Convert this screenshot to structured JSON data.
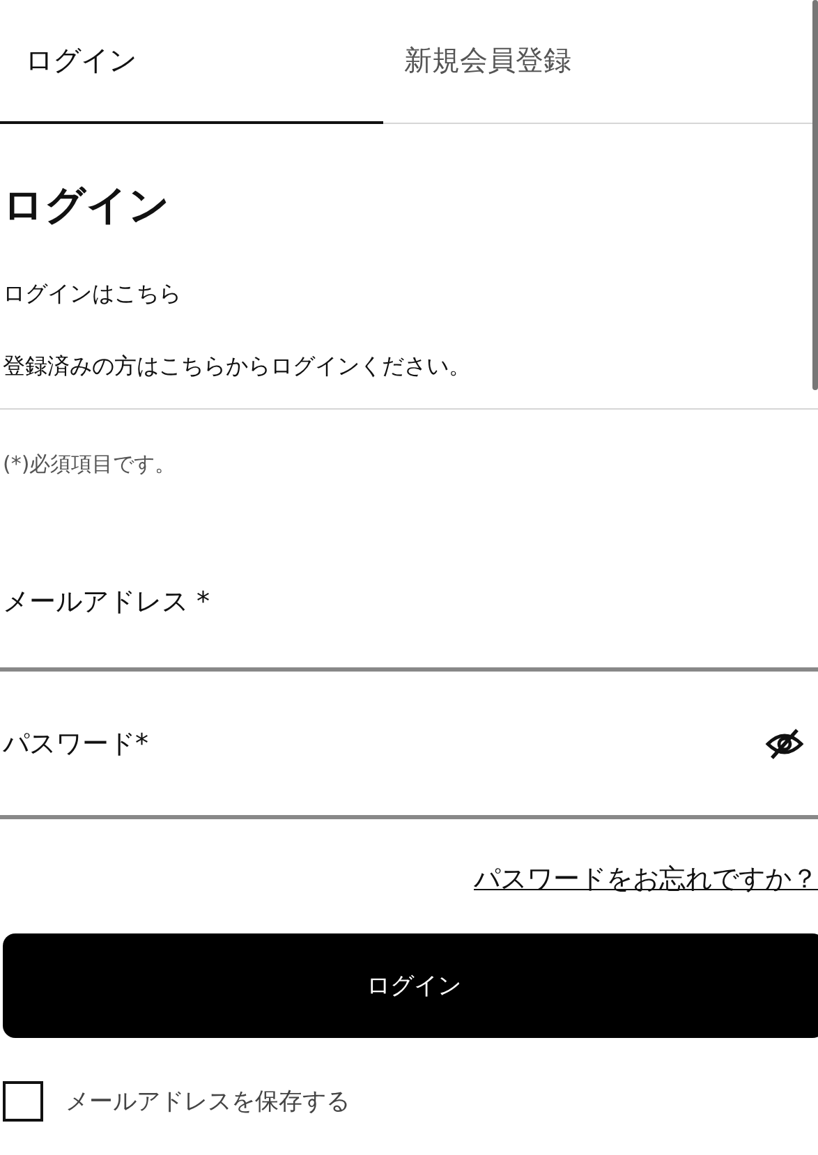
{
  "tabs": [
    {
      "label": "ログイン",
      "selected": true
    },
    {
      "label": "新規会員登録",
      "selected": false
    }
  ],
  "heading": "ログイン",
  "intro": [
    "ログインはこちら",
    "登録済みの方はこちらからログインください。"
  ],
  "required_note": "(*)必須項目です。",
  "fields": [
    {
      "kind": "text",
      "placeholder": "メールアドレス *"
    },
    {
      "kind": "password",
      "placeholder": "パスワード*",
      "masked": true
    }
  ],
  "forgot_link": "パスワードをお忘れですか？",
  "submit_button": "ログイン",
  "remember": {
    "label": "メールアドレスを保存する",
    "checked": false
  }
}
